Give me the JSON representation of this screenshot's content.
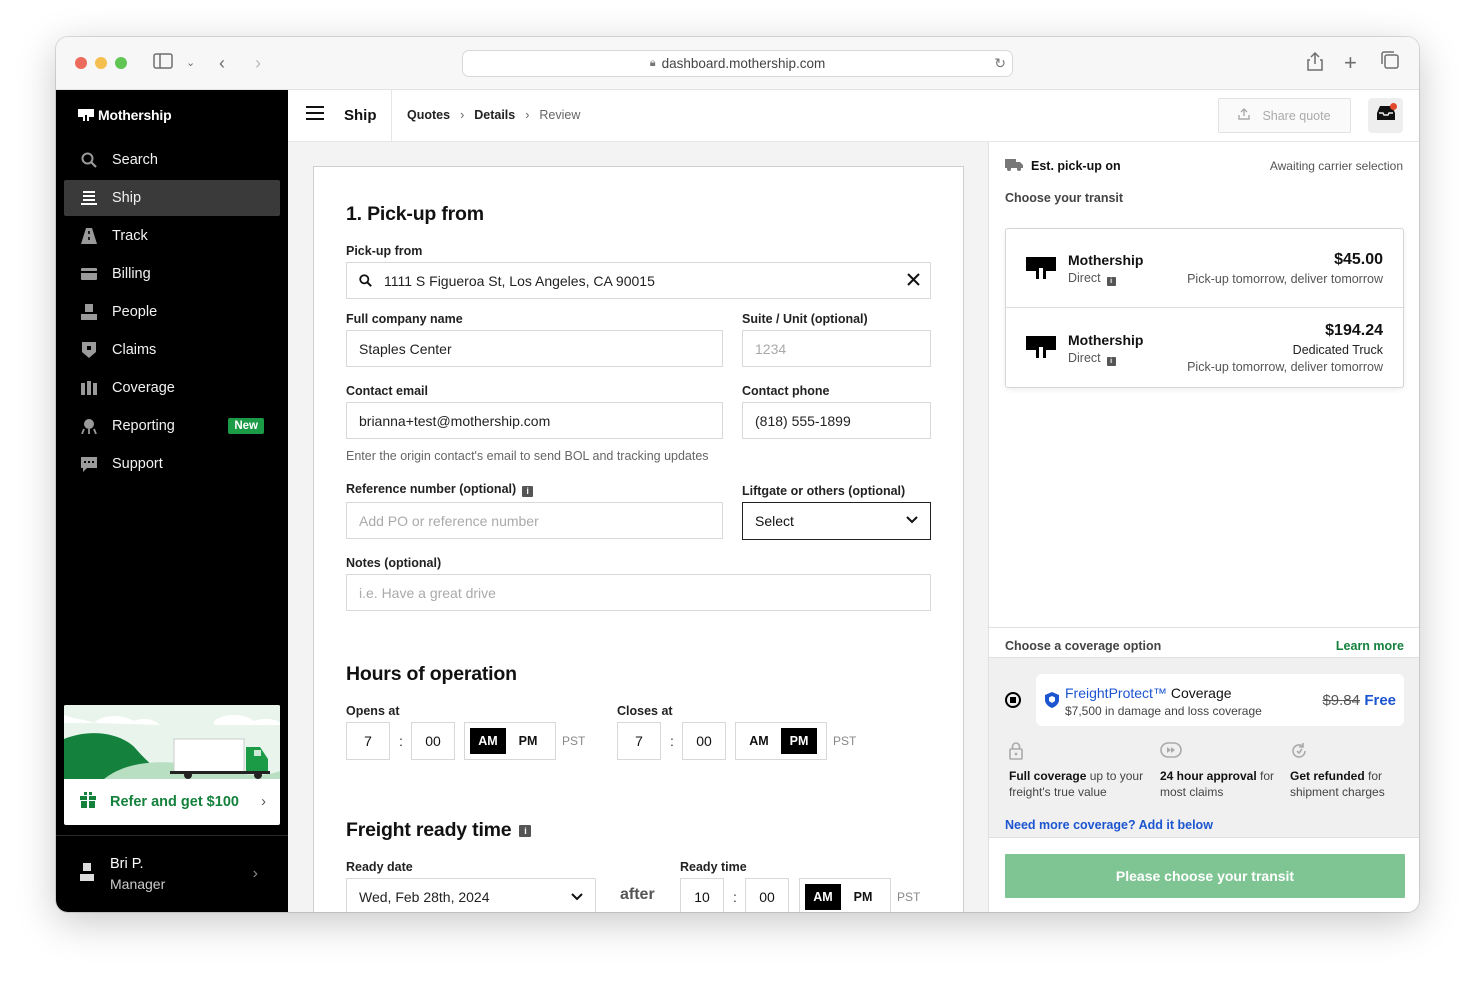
{
  "browser": {
    "url": "dashboard.mothership.com"
  },
  "sidebar": {
    "brand": "Mothership",
    "items": [
      {
        "label": "Search",
        "icon": "search-icon"
      },
      {
        "label": "Ship",
        "icon": "ship-icon",
        "active": true
      },
      {
        "label": "Track",
        "icon": "track-icon"
      },
      {
        "label": "Billing",
        "icon": "billing-icon"
      },
      {
        "label": "People",
        "icon": "people-icon"
      },
      {
        "label": "Claims",
        "icon": "claims-icon"
      },
      {
        "label": "Coverage",
        "icon": "coverage-icon"
      },
      {
        "label": "Reporting",
        "icon": "reporting-icon",
        "badge": "New"
      },
      {
        "label": "Support",
        "icon": "support-icon"
      }
    ],
    "refer": {
      "label": "Refer and get $100"
    },
    "user": {
      "name": "Bri P.",
      "role": "Manager"
    }
  },
  "topbar": {
    "title": "Ship",
    "breadcrumbs": [
      "Quotes",
      "Details",
      "Review"
    ],
    "share_label": "Share quote"
  },
  "form": {
    "section1_title": "1. Pick-up from",
    "pickup_label": "Pick-up from",
    "pickup_value": "1111 S Figueroa St, Los Angeles, CA 90015",
    "company_label": "Full company name",
    "company_value": "Staples Center",
    "suite_label": "Suite / Unit (optional)",
    "suite_placeholder": "1234",
    "email_label": "Contact email",
    "email_value": "brianna+test@mothership.com",
    "email_hint": "Enter the origin contact's email to send BOL and tracking updates",
    "phone_label": "Contact phone",
    "phone_value": "(818) 555-1899",
    "ref_label": "Reference number (optional)",
    "ref_placeholder": "Add PO or reference number",
    "liftgate_label": "Liftgate or others (optional)",
    "liftgate_value": "Select",
    "notes_label": "Notes (optional)",
    "notes_placeholder": "i.e. Have a great drive",
    "hours_title": "Hours of operation",
    "opens_label": "Opens at",
    "opens_hour": "7",
    "opens_min": "00",
    "opens_period": "AM",
    "closes_label": "Closes at",
    "closes_hour": "7",
    "closes_min": "00",
    "closes_period": "PM",
    "am": "AM",
    "pm": "PM",
    "tz": "PST",
    "freight_title": "Freight ready time",
    "ready_date_label": "Ready date",
    "ready_date_value": "Wed, Feb 28th, 2024",
    "after": "after",
    "ready_time_label": "Ready time",
    "ready_hour": "10",
    "ready_min": "00",
    "ready_period": "AM"
  },
  "right": {
    "pickup_title": "Est. pick-up on",
    "pickup_status": "Awaiting carrier selection",
    "transit_label": "Choose your transit",
    "quotes": [
      {
        "carrier": "Mothership",
        "sub": "Direct",
        "price": "$45.00",
        "type": "",
        "window": "Pick-up tomorrow, deliver tomorrow"
      },
      {
        "carrier": "Mothership",
        "sub": "Direct",
        "price": "$194.24",
        "type": "Dedicated Truck",
        "window": "Pick-up tomorrow, deliver tomorrow"
      }
    ],
    "coverage_label": "Choose a coverage option",
    "learn_more": "Learn more",
    "fp_brand": "FreightProtect™",
    "fp_word": "Coverage",
    "fp_desc": "$7,500 in damage and loss coverage",
    "fp_old_price": "$9.84",
    "fp_price": "Free",
    "features": [
      {
        "bold": "Full coverage",
        "rest": " up to your freight's true value"
      },
      {
        "bold": "24 hour approval",
        "rest": " for most claims"
      },
      {
        "bold": "Get refunded",
        "rest": " for shipment charges"
      }
    ],
    "need_more": "Need more coverage? Add it below",
    "cta": "Please choose your transit"
  },
  "colors": {
    "accent_green": "#14813d",
    "link_blue": "#1c55d0",
    "cta_disabled": "#7fc593"
  }
}
